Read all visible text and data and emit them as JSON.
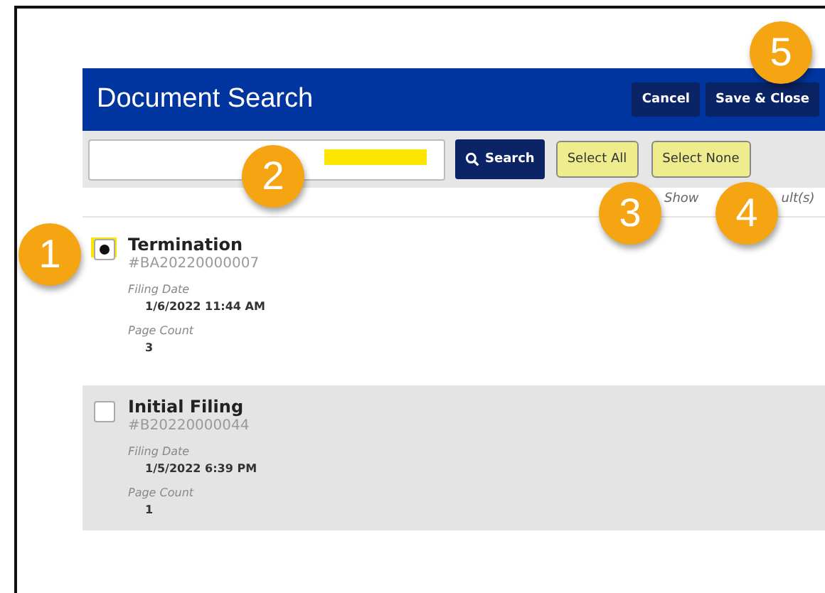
{
  "header": {
    "title": "Document Search",
    "buttons": [
      {
        "label": "Cancel"
      },
      {
        "label": "Save & Close"
      }
    ]
  },
  "toolbar": {
    "search_field": {
      "highlighted": true
    },
    "search_button": "Search",
    "select_buttons": [
      {
        "label": "Select All",
        "highlighted": true
      },
      {
        "label": "Select None",
        "highlighted": true
      }
    ]
  },
  "result_count": [
    "Show",
    "ult(s)"
  ],
  "results": [
    {
      "title": "Termination",
      "number": "#BA20220000007",
      "checked": true,
      "highlighted": true,
      "selected": false,
      "fields": [
        {
          "label": "Filing Date",
          "value": "1/6/2022 11:44 AM"
        },
        {
          "label": "Page Count",
          "value": "3"
        }
      ]
    },
    {
      "title": "Initial Filing",
      "number": "#B20220000044",
      "checked": false,
      "highlighted": false,
      "selected": true,
      "fields": [
        {
          "label": "Filing Date",
          "value": "1/5/2022 6:39 PM"
        },
        {
          "label": "Page Count",
          "value": "1"
        }
      ]
    }
  ],
  "callouts": [
    "1",
    "2",
    "3",
    "4",
    "5"
  ]
}
